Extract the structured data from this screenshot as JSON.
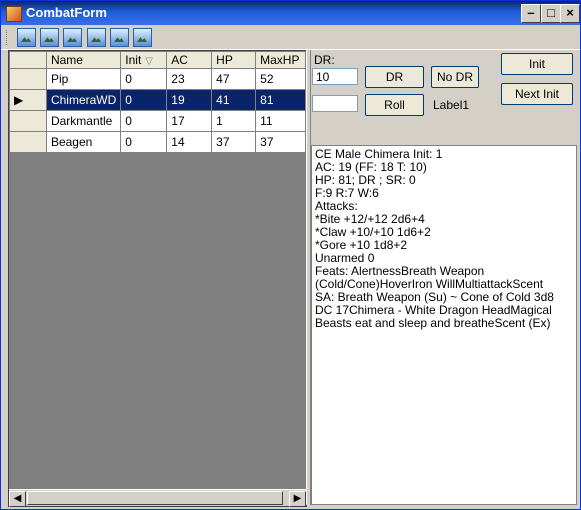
{
  "window": {
    "title": "CombatForm",
    "minimize_icon": "minimize-icon",
    "maximize_icon": "maximize-icon",
    "close_icon": "close-icon"
  },
  "toolbar": {
    "buttons": [
      "image-icon",
      "image-icon",
      "image-icon",
      "image-icon",
      "image-icon",
      "image-icon"
    ]
  },
  "grid": {
    "columns": [
      "Name",
      "Init",
      "AC",
      "HP",
      "MaxHP"
    ],
    "rows": [
      {
        "name": "Pip",
        "init": "0",
        "ac": "23",
        "hp": "47",
        "maxhp": "52"
      },
      {
        "name": "ChimeraWD",
        "init": "0",
        "ac": "19",
        "hp": "41",
        "maxhp": "81"
      },
      {
        "name": "Darkmantle",
        "init": "0",
        "ac": "17",
        "hp": "1",
        "maxhp": "11"
      },
      {
        "name": "Beagen",
        "init": "0",
        "ac": "14",
        "hp": "37",
        "maxhp": "37"
      }
    ]
  },
  "controls": {
    "dr_label": "DR:",
    "dr_value": "10",
    "dr_button": "DR",
    "no_dr_button": "No DR",
    "roll_value": "",
    "roll_button": "Roll",
    "label1": "Label1",
    "init_button": "Init",
    "next_init_button": "Next Init"
  },
  "details": {
    "lines": [
      "CE Male Chimera Init: 1",
      "AC: 19 (FF: 18 T: 10)",
      "HP: 81; DR ; SR: 0",
      "F:9 R:7 W:6",
      "Attacks:",
      "*Bite +12/+12 2d6+4",
      "*Claw +10/+10 1d6+2",
      "*Gore +10 1d8+2",
      "Unarmed  0",
      "Feats: AlertnessBreath Weapon (Cold/Cone)HoverIron WillMultiattackScent",
      "SA: Breath Weapon (Su) ~ Cone of Cold 3d8 DC 17Chimera - White Dragon HeadMagical Beasts eat and sleep and breatheScent (Ex)"
    ]
  }
}
